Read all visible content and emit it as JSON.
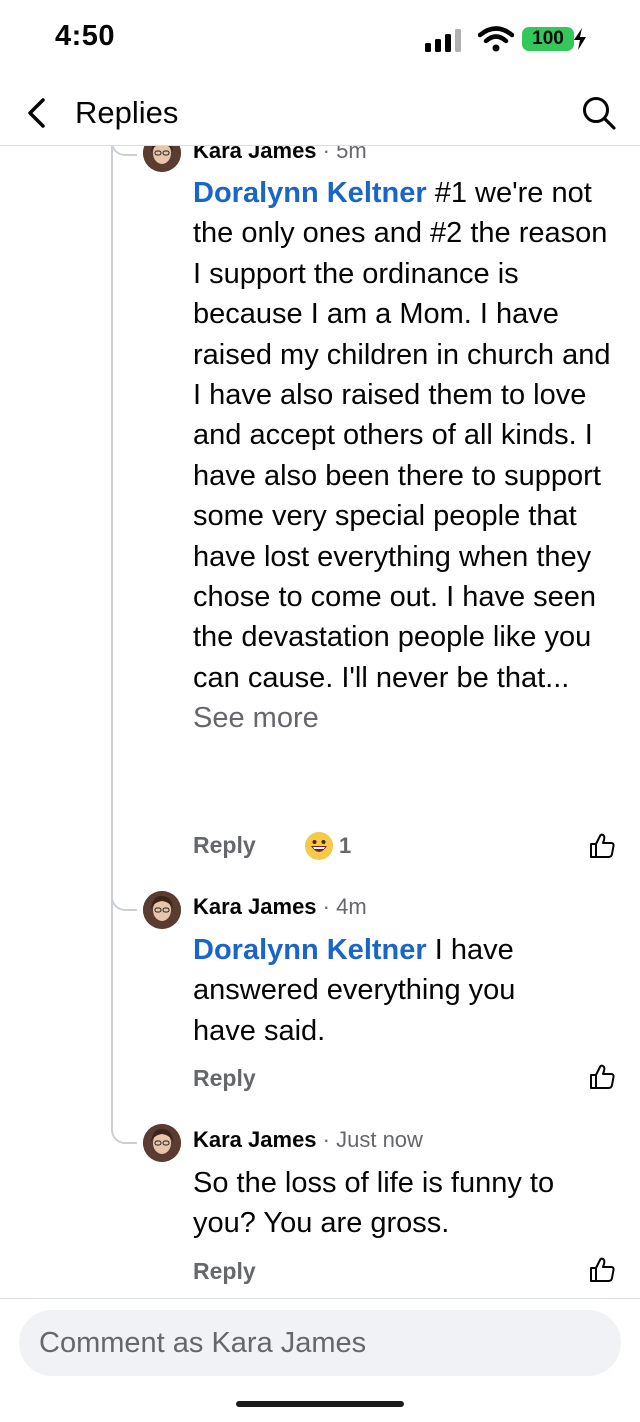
{
  "status_bar": {
    "time": "4:50",
    "battery": "100",
    "battery_color": "#34c759"
  },
  "nav": {
    "title": "Replies",
    "back_icon": "chevron-left-icon",
    "search_icon": "search-icon"
  },
  "comments": [
    {
      "author": "Kara James",
      "time_prefix": " · ",
      "time": "5m",
      "mention": "Doralynn Keltner",
      "text": " #1 we're not the only ones and #2 the reason I support the ordinance is because I am a Mom. I have raised my children in church and I have also raised them to love and accept others of all kinds. I have also been there to support some very special people that have lost everything when they chose to come out. I have seen the devastation people like you can cause. I'll never be that...",
      "see_more": "See more",
      "reply_label": "Reply",
      "reaction_icon": "grinning-face-emoji",
      "reaction_count": "1"
    },
    {
      "author": "Kara James",
      "time_prefix": " · ",
      "time": "4m",
      "mention": "Doralynn Keltner",
      "text": " I have answered everything you have said.",
      "reply_label": "Reply"
    },
    {
      "author": "Kara James",
      "time_prefix": " · ",
      "time": "Just now",
      "text": "So the loss of life is funny to you? You are gross.",
      "reply_label": "Reply"
    }
  ],
  "composer": {
    "placeholder": "Comment as Kara James"
  },
  "colors": {
    "mention": "#1a65c8",
    "secondary_text": "#65676b",
    "thread_line": "#ccd0d5",
    "composer_bg": "#f0f2f5"
  }
}
